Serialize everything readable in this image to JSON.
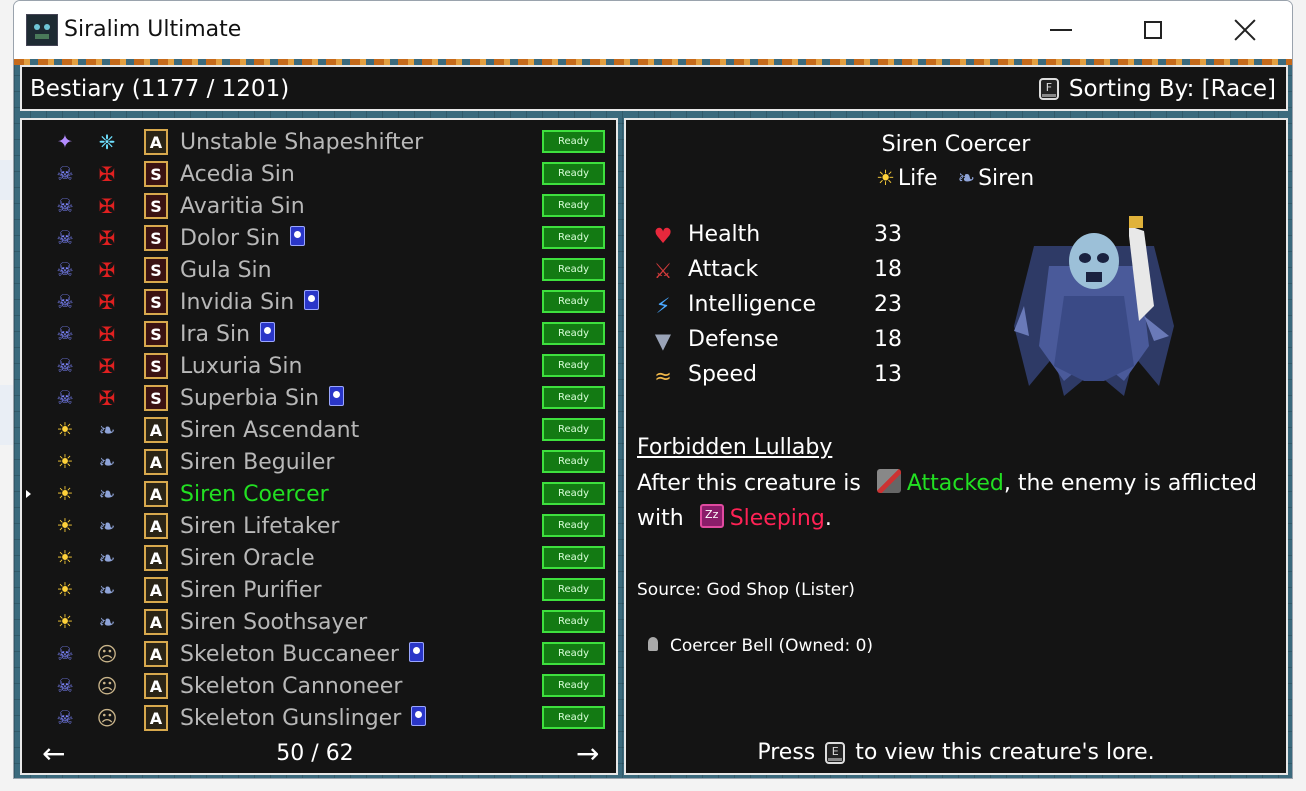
{
  "window": {
    "title": "Siralim Ultimate",
    "app_icon": "siralim-app-icon",
    "controls": [
      "minimize-icon",
      "maximize-icon",
      "close-icon"
    ]
  },
  "header": {
    "title": "Bestiary (1177 / 1201)",
    "sort_key": "F",
    "sort_label": "Sorting By: [Race]"
  },
  "list": {
    "ready_label": "Ready",
    "selected_index": 11,
    "items": [
      {
        "name": "Unstable Shapeshifter",
        "class_icon": "nether-sparkle-icon",
        "race_icon": "shapeshifter-race-icon",
        "type": "A",
        "card": false
      },
      {
        "name": "Acedia Sin",
        "class_icon": "death-class-icon",
        "race_icon": "sin-race-icon",
        "type": "S",
        "card": false
      },
      {
        "name": "Avaritia Sin",
        "class_icon": "death-class-icon",
        "race_icon": "sin-race-icon",
        "type": "S",
        "card": false
      },
      {
        "name": "Dolor Sin",
        "class_icon": "death-class-icon",
        "race_icon": "sin-race-icon",
        "type": "S",
        "card": true
      },
      {
        "name": "Gula Sin",
        "class_icon": "death-class-icon",
        "race_icon": "sin-race-icon",
        "type": "S",
        "card": false
      },
      {
        "name": "Invidia Sin",
        "class_icon": "death-class-icon",
        "race_icon": "sin-race-icon",
        "type": "S",
        "card": true
      },
      {
        "name": "Ira Sin",
        "class_icon": "death-class-icon",
        "race_icon": "sin-race-icon",
        "type": "S",
        "card": true
      },
      {
        "name": "Luxuria Sin",
        "class_icon": "death-class-icon",
        "race_icon": "sin-race-icon",
        "type": "S",
        "card": false
      },
      {
        "name": "Superbia Sin",
        "class_icon": "death-class-icon",
        "race_icon": "sin-race-icon",
        "type": "S",
        "card": true
      },
      {
        "name": "Siren Ascendant",
        "class_icon": "life-class-icon",
        "race_icon": "siren-race-icon",
        "type": "A",
        "card": false
      },
      {
        "name": "Siren Beguiler",
        "class_icon": "life-class-icon",
        "race_icon": "siren-race-icon",
        "type": "A",
        "card": false
      },
      {
        "name": "Siren Coercer",
        "class_icon": "life-class-icon",
        "race_icon": "siren-race-icon",
        "type": "A",
        "card": false
      },
      {
        "name": "Siren Lifetaker",
        "class_icon": "life-class-icon",
        "race_icon": "siren-race-icon",
        "type": "A",
        "card": false
      },
      {
        "name": "Siren Oracle",
        "class_icon": "life-class-icon",
        "race_icon": "siren-race-icon",
        "type": "A",
        "card": false
      },
      {
        "name": "Siren Purifier",
        "class_icon": "life-class-icon",
        "race_icon": "siren-race-icon",
        "type": "A",
        "card": false
      },
      {
        "name": "Siren Soothsayer",
        "class_icon": "life-class-icon",
        "race_icon": "siren-race-icon",
        "type": "A",
        "card": false
      },
      {
        "name": "Skeleton Buccaneer",
        "class_icon": "death-class-icon",
        "race_icon": "skeleton-race-icon",
        "type": "A",
        "card": true
      },
      {
        "name": "Skeleton Cannoneer",
        "class_icon": "death-class-icon",
        "race_icon": "skeleton-race-icon",
        "type": "A",
        "card": false
      },
      {
        "name": "Skeleton Gunslinger",
        "class_icon": "death-class-icon",
        "race_icon": "skeleton-race-icon",
        "type": "A",
        "card": true
      }
    ],
    "pager": "50 / 62"
  },
  "detail": {
    "name": "Siren Coercer",
    "class_label": "Life",
    "race_label": "Siren",
    "stats": [
      {
        "label": "Health",
        "value": "33",
        "icon": "heart-icon",
        "color": "#e8283c"
      },
      {
        "label": "Attack",
        "value": "18",
        "icon": "sword-icon",
        "color": "#d23b3b"
      },
      {
        "label": "Intelligence",
        "value": "23",
        "icon": "lightning-icon",
        "color": "#4aa8ff"
      },
      {
        "label": "Defense",
        "value": "18",
        "icon": "shield-icon",
        "color": "#9aa4b8"
      },
      {
        "label": "Speed",
        "value": "13",
        "icon": "wing-icon",
        "color": "#f0b84a"
      }
    ],
    "trait_name": "Forbidden Lullaby",
    "trait_desc_1": "After this creature is",
    "trait_keyword_1": "Attacked",
    "trait_desc_2": ", the enemy is afflicted",
    "trait_desc_3": "with",
    "trait_keyword_2": "Sleeping",
    "trait_desc_4": ".",
    "source": "Source: God Shop (Lister)",
    "item": "Coercer Bell (Owned: 0)",
    "lore_prefix": "Press",
    "lore_key": "E",
    "lore_suffix": "to view this creature's lore."
  },
  "colors": {
    "selected": "#22e022",
    "keyword_green": "#22e022",
    "keyword_red": "#ff2255",
    "ready_bg": "#137a13",
    "panel_bg": "#141414"
  }
}
